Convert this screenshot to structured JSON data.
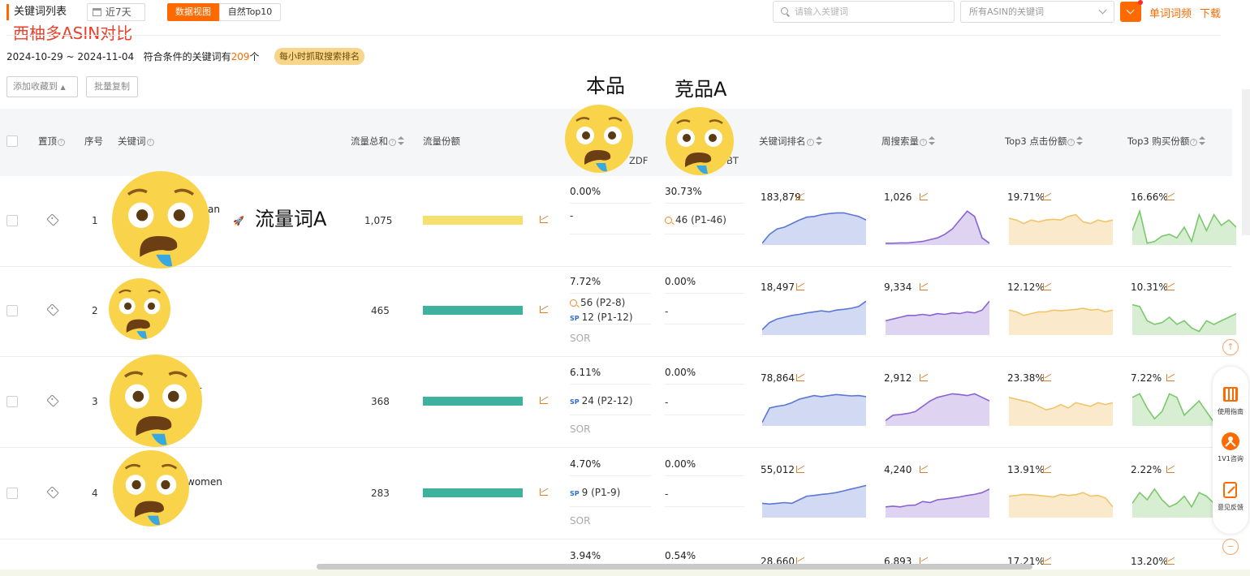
{
  "header": {
    "title": "关键词列表",
    "range_label": "近7天",
    "tabs": [
      "数据视图",
      "自然Top10"
    ],
    "annotation_red": "西柚多ASIN对比",
    "search_placeholder": "请输入关键词",
    "asin_select": "所有ASIN的关键词",
    "link_word_lib": "单词词频",
    "link_download": "下载"
  },
  "summary": {
    "date_range": "2024-10-29 ~ 2024-11-04",
    "count_prefix": "符合条件的关键词有",
    "count": "209",
    "count_suffix": "个",
    "hourly_badge": "每小时抓取搜索排名"
  },
  "actions": {
    "add_fav": "添加收藏到",
    "bulk_copy": "批量复制"
  },
  "overlay_labels": {
    "own": "本品",
    "competitor": "竞品A",
    "traffic_word": "流量词A"
  },
  "columns": {
    "pin": "置顶",
    "index": "序号",
    "keyword": "关键词",
    "traffic_total": "流量总和",
    "traffic_share": "流量份额",
    "own_asin_tail": "ZDF",
    "comp_asin_tail": "BT",
    "kw_rank": "关键词排名",
    "weekly_search": "周搜索量",
    "top3_click": "Top3 点击份额",
    "top3_buy": "Top3 购买份额"
  },
  "rows": [
    {
      "index": "1",
      "keyword_tail": "an",
      "traffic": "1,075",
      "share_fill": 0.93,
      "share_color": "#f5e06e",
      "own_pct": "0.00%",
      "own_rank_line": "-",
      "own_sp_line": "",
      "own_sor": "",
      "comp_pct": "30.73%",
      "comp_rank_line": "46 (P1-46)",
      "kw_rank": "183,879",
      "weekly": "1,026",
      "click": "19.71%",
      "buy": "16.66%"
    },
    {
      "index": "2",
      "keyword_tail": "",
      "traffic": "465",
      "share_fill": 0.93,
      "share_color": "#3fb29e",
      "own_pct": "7.72%",
      "own_rank_line": "56 (P2-8)",
      "own_sp_line": "12 (P1-12)",
      "own_sor": "SOR",
      "comp_pct": "0.00%",
      "comp_rank_line": "-",
      "kw_rank": "18,497",
      "weekly": "9,334",
      "click": "12.12%",
      "buy": "10.31%"
    },
    {
      "index": "3",
      "keyword_tail": "or",
      "traffic": "368",
      "share_fill": 0.93,
      "share_color": "#3fb29e",
      "own_pct": "6.11%",
      "own_rank_line": "",
      "own_sp_line": "24 (P2-12)",
      "own_sor": "SOR",
      "comp_pct": "0.00%",
      "comp_rank_line": "-",
      "kw_rank": "78,864",
      "weekly": "2,912",
      "click": "23.38%",
      "buy": "7.22%"
    },
    {
      "index": "4",
      "keyword_tail": "women",
      "traffic": "283",
      "share_fill": 0.93,
      "share_color": "#3fb29e",
      "own_pct": "4.70%",
      "own_rank_line": "",
      "own_sp_line": "9 (P1-9)",
      "own_sor": "SOR",
      "comp_pct": "0.00%",
      "comp_rank_line": "-",
      "kw_rank": "55,012",
      "weekly": "4,240",
      "click": "13.91%",
      "buy": "2.22%"
    },
    {
      "index": "",
      "keyword_tail": "",
      "traffic": "",
      "share_fill": 0,
      "share_color": "#3fb29e",
      "own_pct": "3.94%",
      "own_rank_line": "",
      "own_sp_line": "",
      "own_sor": "",
      "comp_pct": "0.54%",
      "comp_rank_line": "",
      "kw_rank": "28,660",
      "weekly": "6,893",
      "click": "17.21%",
      "buy": "13.20%"
    }
  ],
  "side_panel": {
    "guide": "使用指南",
    "consult": "1V1咨询",
    "feedback": "意见反馈"
  },
  "colors": {
    "accent": "#ff6a00",
    "rank_line": "#5a78d4",
    "weekly_line": "#8a63d2",
    "click_line": "#f2c46a",
    "buy_line": "#7bc86c"
  }
}
